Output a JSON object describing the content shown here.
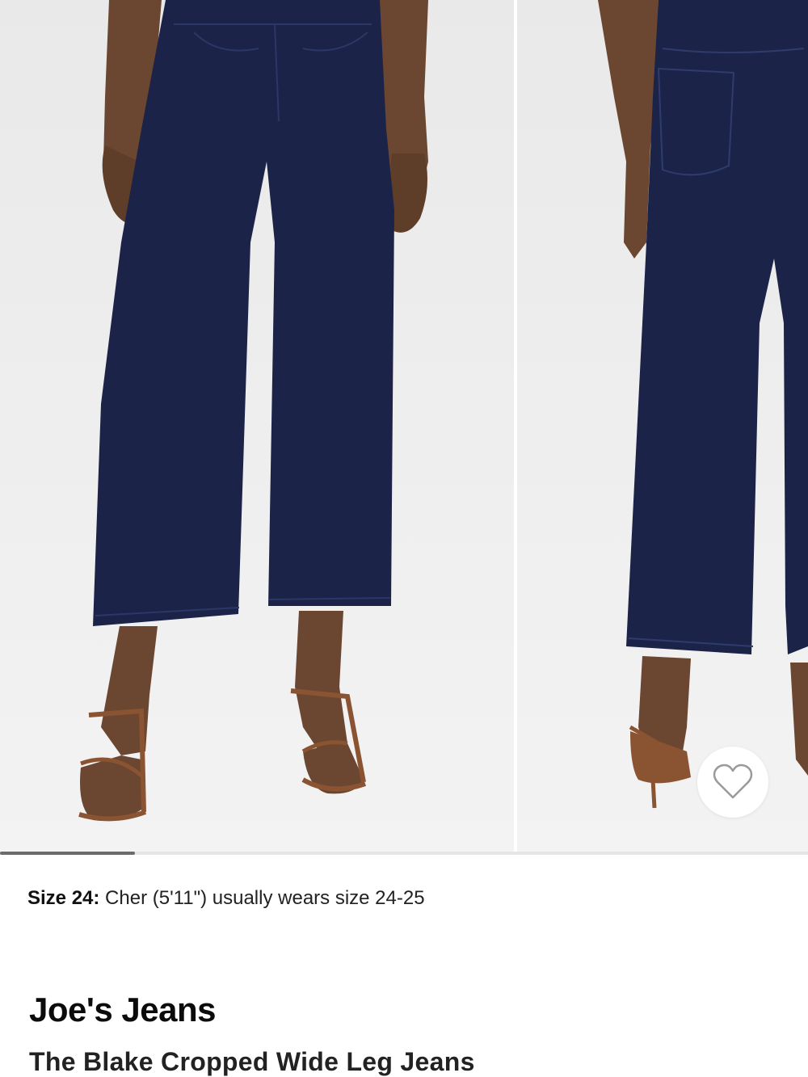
{
  "gallery": {
    "images": [
      {
        "alt": "front view"
      },
      {
        "alt": "back view"
      }
    ],
    "progress": 0.167
  },
  "favorite": {
    "icon": "heart-outline-icon"
  },
  "size_note": {
    "label": "Size 24:",
    "text": " Cher (5'11\") usually wears size 24-25"
  },
  "product": {
    "brand": "Joe's Jeans",
    "name": "The Blake Cropped Wide Leg Jeans"
  },
  "colors": {
    "denim": "#1b2448",
    "skin": "#6b4630",
    "sandal": "#8a5432",
    "background": "#ececec"
  }
}
